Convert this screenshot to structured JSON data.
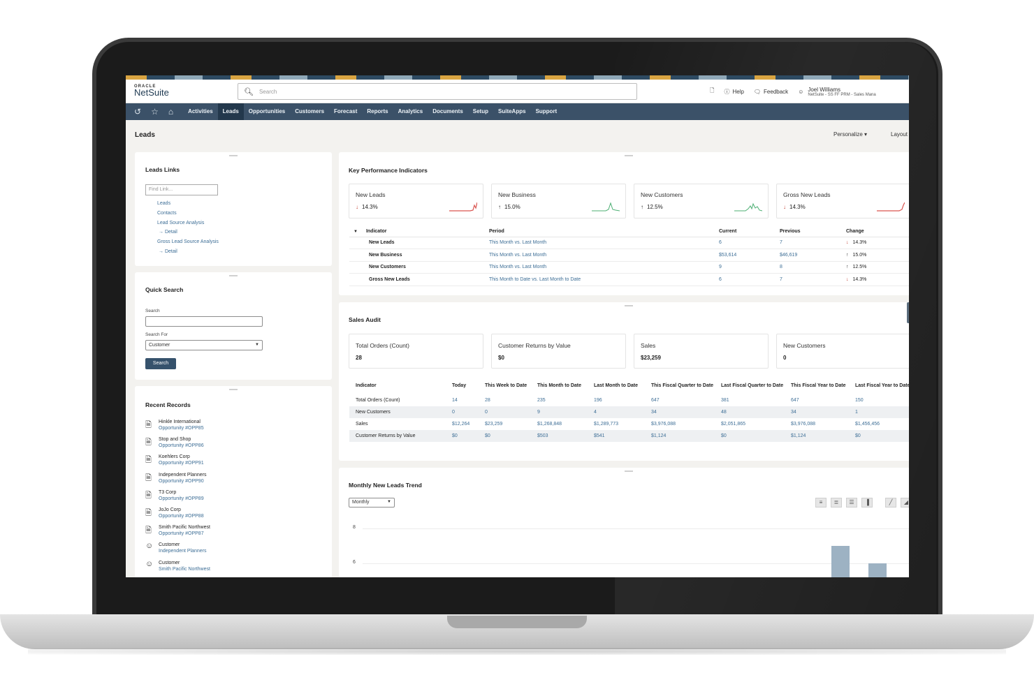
{
  "app": {
    "brand_small": "ORACLE",
    "brand": "NetSuite"
  },
  "search": {
    "placeholder": "Search"
  },
  "topbar": {
    "help": "Help",
    "feedback": "Feedback",
    "user_name": "Joel Williams",
    "user_role": "NetSuite - SS FF PRM - Sales Mana"
  },
  "nav": {
    "tabs": [
      "Activities",
      "Leads",
      "Opportunities",
      "Customers",
      "Forecast",
      "Reports",
      "Analytics",
      "Documents",
      "Setup",
      "SuiteApps",
      "Support"
    ],
    "active": "Leads"
  },
  "page": {
    "title": "Leads",
    "personalize": "Personalize",
    "layout": "Layout"
  },
  "leads_links": {
    "title": "Leads Links",
    "find_placeholder": "Find Link...",
    "links": [
      "Leads",
      "Contacts",
      "Lead Source Analysis",
      "→ Detail",
      "Gross Lead Source Analysis",
      "→ Detail"
    ]
  },
  "quick_search": {
    "title": "Quick Search",
    "search_label": "Search",
    "search_for_label": "Search For",
    "search_for_value": "Customer",
    "button": "Search"
  },
  "recent_records": {
    "title": "Recent Records",
    "items": [
      {
        "name": "Hinkle International",
        "sub": "Opportunity #OPP85"
      },
      {
        "name": "Stop and Shop",
        "sub": "Opportunity #OPP86"
      },
      {
        "name": "Koehlers Corp",
        "sub": "Opportunity #OPP91"
      },
      {
        "name": "Independent Planners",
        "sub": "Opportunity #OPP90"
      },
      {
        "name": "T3 Corp",
        "sub": "Opportunity #OPP89"
      },
      {
        "name": "JoJo Corp",
        "sub": "Opportunity #OPP88"
      },
      {
        "name": "Smith Pacific Northwest",
        "sub": "Opportunity #OPP87"
      },
      {
        "name": "Customer",
        "sub": "Independent Planners"
      },
      {
        "name": "Customer",
        "sub": "Smith Pacific Northwest"
      }
    ]
  },
  "kpi": {
    "title": "Key Performance Indicators",
    "cards": [
      {
        "label": "New Leads",
        "value": "14.3%",
        "dir": "down",
        "color": "#d9534f"
      },
      {
        "label": "New Business",
        "value": "15.0%",
        "dir": "up",
        "color": "#4caf73"
      },
      {
        "label": "New Customers",
        "value": "12.5%",
        "dir": "up",
        "color": "#4caf73"
      },
      {
        "label": "Gross New Leads",
        "value": "14.3%",
        "dir": "down",
        "color": "#d9534f"
      }
    ],
    "headers": [
      "Indicator",
      "Period",
      "Current",
      "Previous",
      "Change"
    ],
    "rows": [
      {
        "indicator": "New Leads",
        "period": "This Month vs. Last Month",
        "current": "6",
        "previous": "7",
        "change": "14.3%",
        "dir": "down"
      },
      {
        "indicator": "New Business",
        "period": "This Month vs. Last Month",
        "current": "$53,614",
        "previous": "$46,619",
        "change": "15.0%",
        "dir": "up"
      },
      {
        "indicator": "New Customers",
        "period": "This Month vs. Last Month",
        "current": "9",
        "previous": "8",
        "change": "12.5%",
        "dir": "up"
      },
      {
        "indicator": "Gross New Leads",
        "period": "This Month to Date vs. Last Month to Date",
        "current": "6",
        "previous": "7",
        "change": "14.3%",
        "dir": "down"
      }
    ]
  },
  "sales_audit": {
    "title": "Sales Audit",
    "cards": [
      {
        "label": "Total Orders (Count)",
        "value": "28"
      },
      {
        "label": "Customer Returns by Value",
        "value": "$0"
      },
      {
        "label": "Sales",
        "value": "$23,259"
      },
      {
        "label": "New Customers",
        "value": "0"
      }
    ],
    "headers": [
      "Indicator",
      "Today",
      "This Week to Date",
      "This Month to Date",
      "Last Month to Date",
      "This Fiscal Quarter to Date",
      "Last Fiscal Quarter to Date",
      "This Fiscal Year to Date",
      "Last Fiscal Year to Date"
    ],
    "rows": [
      [
        "Total Orders (Count)",
        "14",
        "28",
        "235",
        "196",
        "647",
        "381",
        "647",
        "150"
      ],
      [
        "New Customers",
        "0",
        "0",
        "9",
        "4",
        "34",
        "48",
        "34",
        "1"
      ],
      [
        "Sales",
        "$12,264",
        "$23,259",
        "$1,268,848",
        "$1,289,773",
        "$3,976,088",
        "$2,051,865",
        "$3,976,088",
        "$1,456,456"
      ],
      [
        "Customer Returns by Value",
        "$0",
        "$0",
        "$503",
        "$541",
        "$1,124",
        "$0",
        "$1,124",
        "$0"
      ]
    ]
  },
  "trend": {
    "title": "Monthly New Leads Trend",
    "period": "Monthly",
    "chart_icons": [
      "bar-h-icon",
      "bar-stack-icon",
      "bar-group-icon",
      "column-icon",
      "line-icon",
      "area-icon"
    ],
    "chart_data": {
      "type": "bar",
      "title": "Monthly New Leads Trend",
      "ytick_labels": [
        "8",
        "6"
      ],
      "visible_bar_values": [
        7,
        6
      ]
    }
  }
}
